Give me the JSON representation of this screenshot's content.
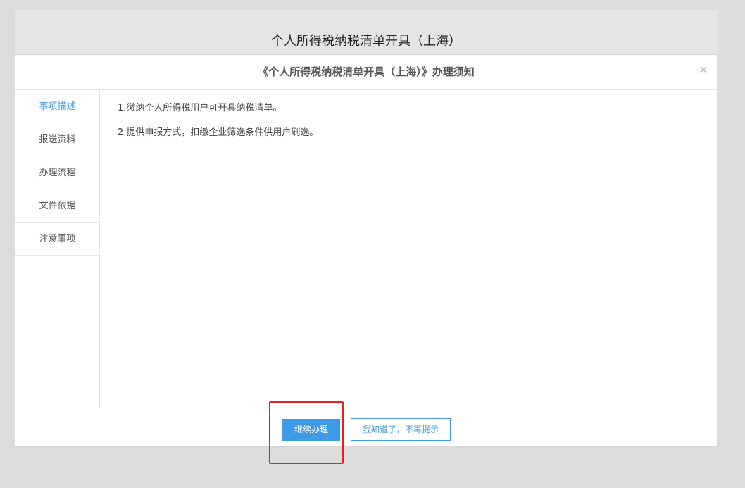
{
  "page": {
    "title": "个人所得税纳税清单开具（上海）"
  },
  "modal": {
    "title": "《个人所得税纳税清单开具（上海）》办理须知",
    "close_glyph": "×",
    "sidebar": {
      "items": [
        {
          "label": "事项描述",
          "active": true
        },
        {
          "label": "报送资料",
          "active": false
        },
        {
          "label": "办理流程",
          "active": false
        },
        {
          "label": "文件依据",
          "active": false
        },
        {
          "label": "注意事项",
          "active": false
        }
      ]
    },
    "content": {
      "paragraphs": [
        "1.缴纳个人所得税用户可开具纳税清单。",
        "2.提供申报方式，扣缴企业筛选条件供用户刷选。"
      ]
    },
    "footer": {
      "continue_label": "继续办理",
      "dismiss_label": "我知道了，不再提示"
    }
  },
  "colors": {
    "accent": "#3f9be6",
    "highlight": "#e5201f",
    "overlay": "#dcdcdc"
  }
}
